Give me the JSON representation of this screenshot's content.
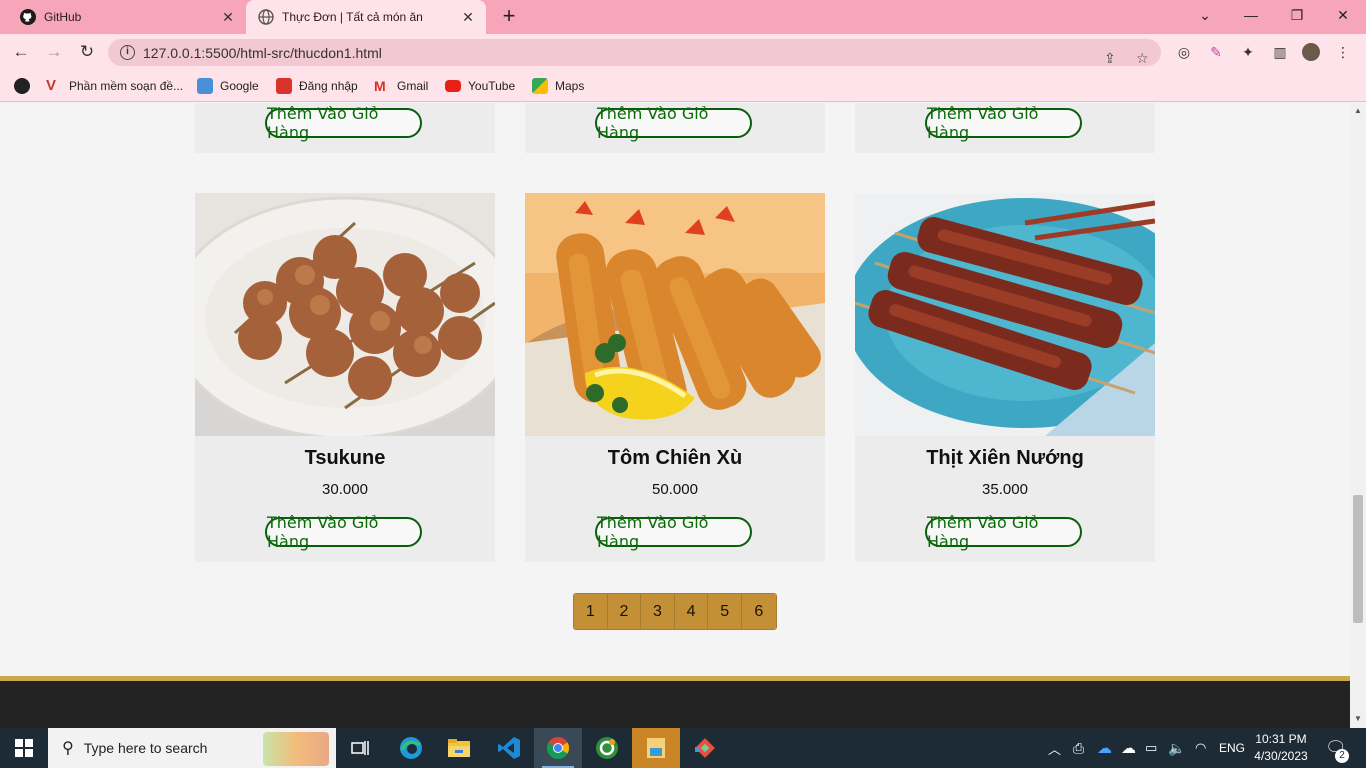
{
  "browser": {
    "tabs": [
      {
        "title": "GitHub"
      },
      {
        "title": "Thực Đơn | Tất cả món ăn"
      }
    ],
    "url": "127.0.0.1:5500/html-src/thucdon1.html",
    "bookmarks": [
      "Phần mềm soạn đề...",
      "Google",
      "Đăng nhập",
      "Gmail",
      "YouTube",
      "Maps"
    ]
  },
  "menu": {
    "top_row_buttons": [
      "Thêm Vào Giỏ Hàng",
      "Thêm Vào Giỏ Hàng",
      "Thêm Vào Giỏ Hàng"
    ],
    "items": [
      {
        "name": "Tsukune",
        "price": "30.000",
        "button": "Thêm Vào Giỏ Hàng"
      },
      {
        "name": "Tôm Chiên Xù",
        "price": "50.000",
        "button": "Thêm Vào Giỏ Hàng"
      },
      {
        "name": "Thịt Xiên Nướng",
        "price": "35.000",
        "button": "Thêm Vào Giỏ Hàng"
      }
    ],
    "pages": [
      "1",
      "2",
      "3",
      "4",
      "5",
      "6"
    ]
  },
  "taskbar": {
    "search_placeholder": "Type here to search",
    "language": "ENG",
    "time": "10:31 PM",
    "date": "4/30/2023",
    "notification_count": "2"
  },
  "colors": {
    "tab_bar": "#f6a6b8",
    "toolbar": "#ffe3ea",
    "button_border": "#0a5e0a",
    "pagination": "#c39038",
    "footer": "#232323",
    "footer_accent": "#c9a84c"
  }
}
